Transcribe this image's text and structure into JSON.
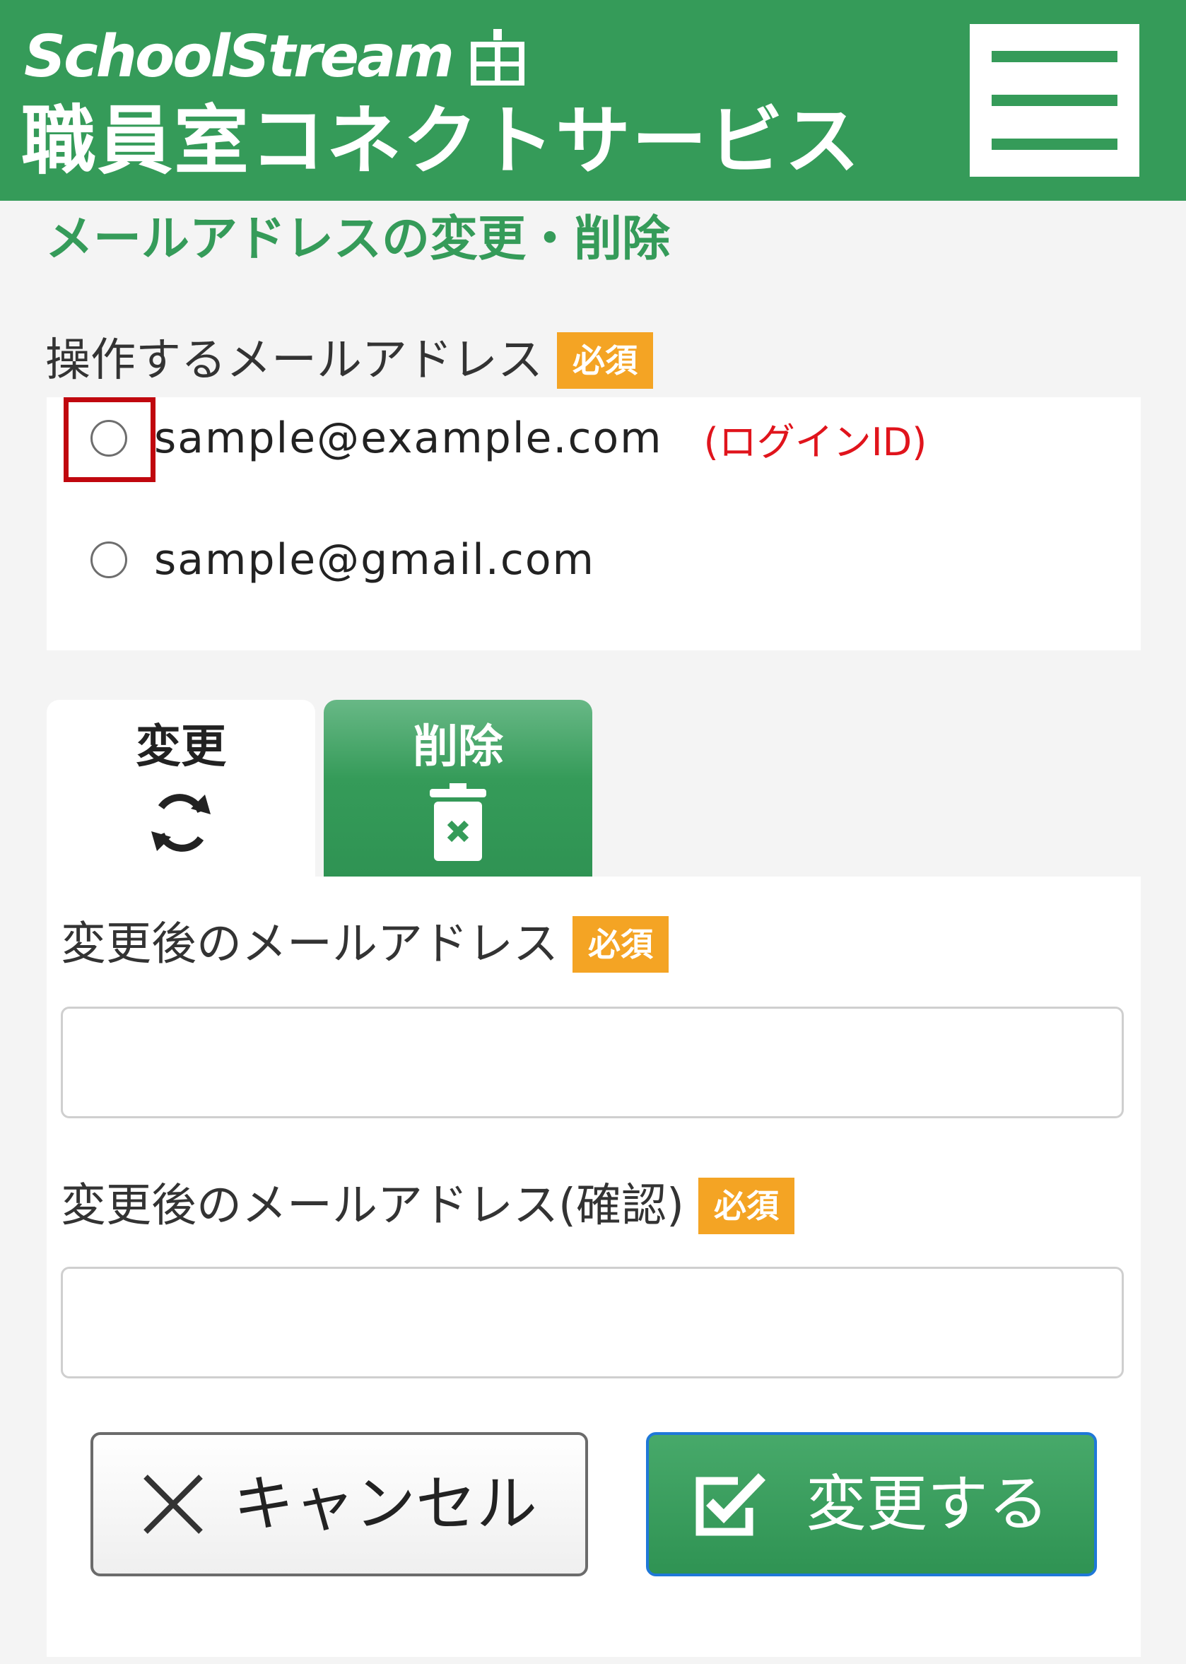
{
  "header": {
    "brand": "SchoolStream",
    "service_name": "職員室コネクトサービス",
    "brand_color": "#359b59"
  },
  "page": {
    "title": "メールアドレスの変更・削除"
  },
  "target_email": {
    "label": "操作するメールアドレス",
    "required_badge": "必須",
    "options": [
      {
        "email": "sample@example.com",
        "note": "(ログインID)",
        "selected": false
      },
      {
        "email": "sample@gmail.com",
        "note": "",
        "selected": false
      }
    ]
  },
  "tabs": [
    {
      "label": "変更",
      "icon": "refresh-icon",
      "active": true
    },
    {
      "label": "削除",
      "icon": "trash-icon",
      "active": false
    }
  ],
  "form": {
    "new_email_label": "変更後のメールアドレス",
    "confirm_email_label": "変更後のメールアドレス(確認)",
    "required_badge": "必須",
    "new_email_value": "",
    "confirm_email_value": ""
  },
  "buttons": {
    "cancel_label": "キャンセル",
    "submit_label": "変更する"
  },
  "colors": {
    "accent": "#359b59",
    "badge": "#f4a424",
    "login_id_text": "#e0141c",
    "highlight_box": "#c0070e"
  }
}
